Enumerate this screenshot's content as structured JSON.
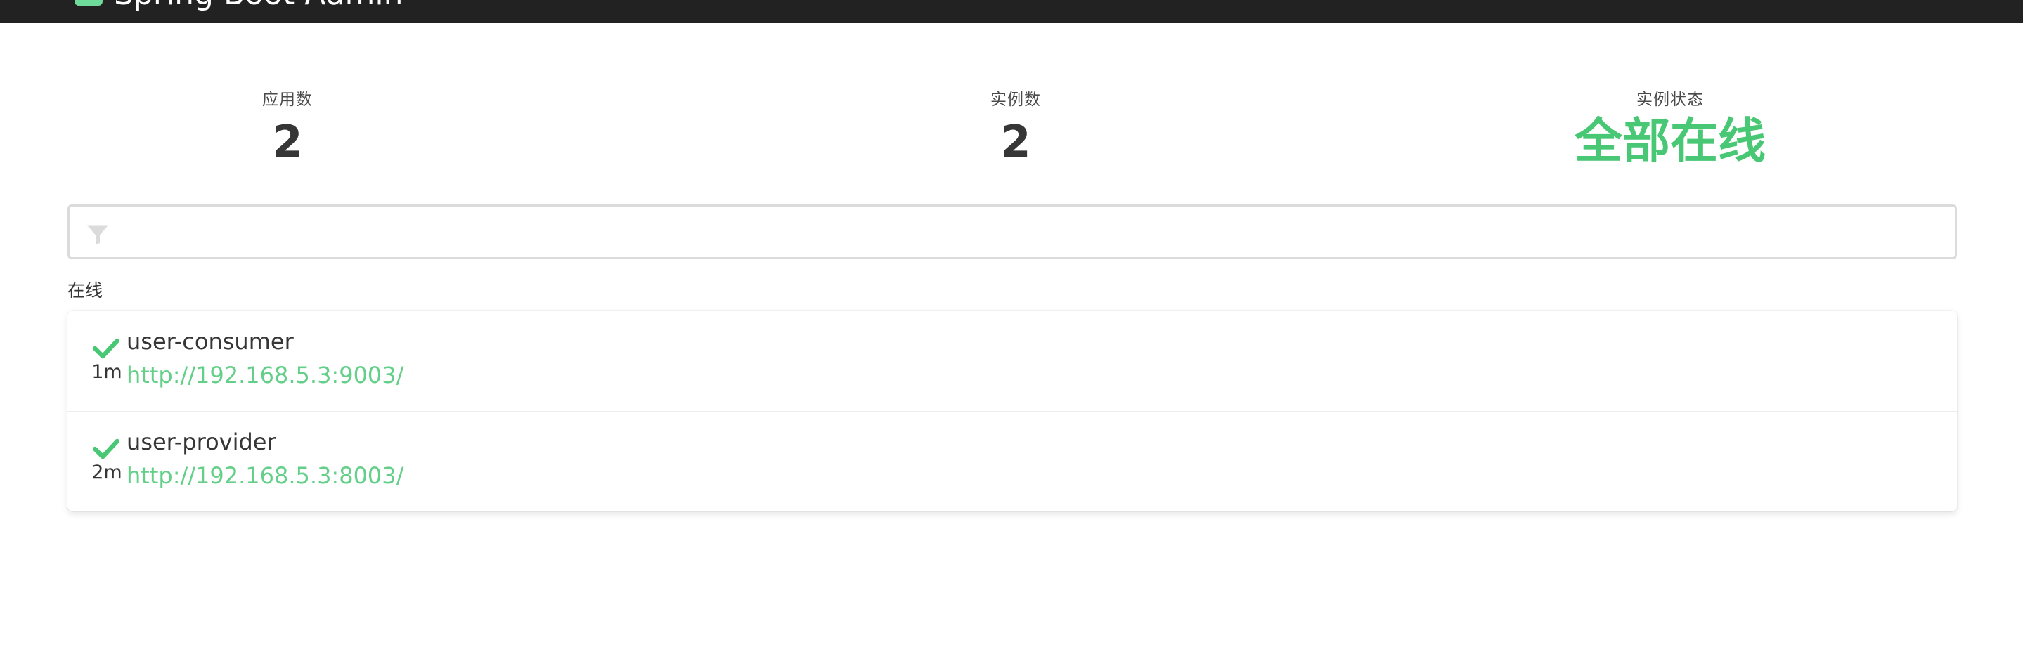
{
  "header": {
    "brand": "Spring Boot Admin",
    "logo_color": "#6fdb9b",
    "bar_color": "#222222"
  },
  "stats": {
    "apps_label": "应用数",
    "apps_value": "2",
    "instances_label": "实例数",
    "instances_value": "2",
    "status_label": "实例状态",
    "status_value": "全部在线",
    "status_color": "#48c774"
  },
  "filter": {
    "placeholder": "",
    "value": "",
    "icon": "filter-icon"
  },
  "group": {
    "title": "在线",
    "applications": [
      {
        "name": "user-consumer",
        "url": "http://192.168.5.3:9003/",
        "uptime": "1m",
        "status_icon": "check-icon"
      },
      {
        "name": "user-provider",
        "url": "http://192.168.5.3:8003/",
        "uptime": "2m",
        "status_icon": "check-icon"
      }
    ]
  }
}
